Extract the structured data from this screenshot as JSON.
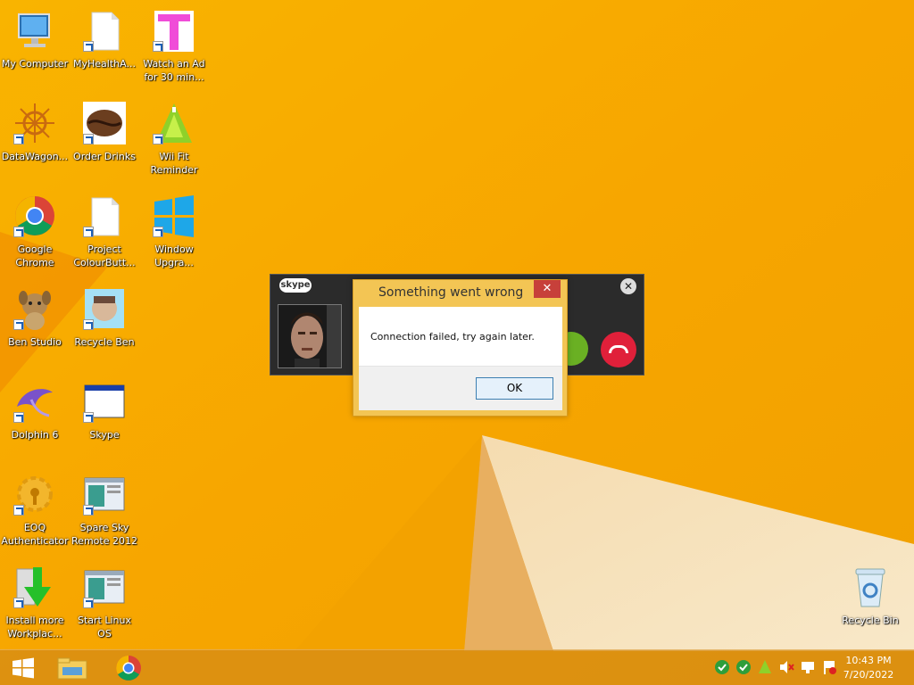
{
  "desktop": {
    "icons": [
      {
        "label": "My Computer",
        "icon": "computer-icon"
      },
      {
        "label": "MyHealthA...",
        "icon": "document-icon"
      },
      {
        "label": "Watch an Ad\nfor 30 min...",
        "icon": "t-letter-icon"
      },
      {
        "label": "DataWagon...",
        "icon": "sunburst-icon"
      },
      {
        "label": "Order Drinks",
        "icon": "coffee-bean-icon"
      },
      {
        "label": "Wii Fit\nReminder",
        "icon": "green-tree-icon"
      },
      {
        "label": "Google\nChrome",
        "icon": "chrome-icon"
      },
      {
        "label": "Project\nColourButt...",
        "icon": "document-icon"
      },
      {
        "label": "Window\nUpgra...",
        "icon": "windows-logo-icon"
      },
      {
        "label": "Ben Studio",
        "icon": "dog-icon"
      },
      {
        "label": "Recycle Ben",
        "icon": "recycle-face-icon"
      },
      {
        "label": "Dolphin 6",
        "icon": "dolphin-icon"
      },
      {
        "label": "Skype",
        "icon": "window-icon"
      },
      {
        "label": "EOQ\nAuthenticator",
        "icon": "gear-key-icon"
      },
      {
        "label": "Spare Sky\nRemote 2012",
        "icon": "window-icon"
      },
      {
        "label": "Install more\nWorkplac...",
        "icon": "download-arrow-icon"
      },
      {
        "label": "Start Linux\nOS",
        "icon": "window-icon"
      },
      {
        "label": "Recycle Bin",
        "icon": "recycle-bin-icon"
      }
    ]
  },
  "skype_call": {
    "logo_text": "skype",
    "close_glyph": "✕"
  },
  "dialog": {
    "title": "Something went wrong",
    "message": "Connection failed, try again later.",
    "ok_label": "OK",
    "close_glyph": "✕"
  },
  "taskbar": {
    "clock_time": "10:43 PM",
    "clock_date": "7/20/2022"
  },
  "colors": {
    "wallpaper": "#f7a600",
    "dialog_frame": "#f3c554",
    "close_red": "#c7403a",
    "answer_green": "#6ab023",
    "hangup_red": "#e0203a"
  }
}
